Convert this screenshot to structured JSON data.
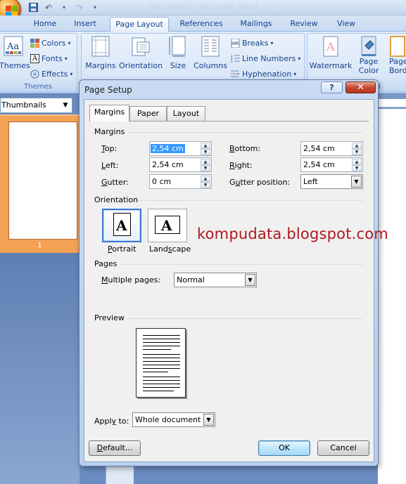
{
  "window": {
    "title_text": "Document1 - Microsoft Word"
  },
  "ribbon": {
    "tabs": [
      "Home",
      "Insert",
      "Page Layout",
      "References",
      "Mailings",
      "Review",
      "View"
    ],
    "active_tab": "Page Layout",
    "themes_group": {
      "themes_label": "Themes",
      "colors_label": "Colors",
      "fonts_label": "Fonts",
      "effects_label": "Effects",
      "group_label": "Themes"
    },
    "page_setup_group": {
      "margins_label": "Margins",
      "orientation_label": "Orientation",
      "size_label": "Size",
      "columns_label": "Columns",
      "breaks_label": "Breaks",
      "line_numbers_label": "Line Numbers",
      "hyphenation_label": "Hyphenation"
    },
    "background_group": {
      "watermark_label": "Watermark",
      "page_color_label_1": "Page",
      "page_color_label_2": "Color",
      "page_borders_label_1": "Page",
      "page_borders_label_2": "Borde",
      "group_label_fragment": "und"
    }
  },
  "thumbnails": {
    "header": "Thumbnails",
    "page_number": "1"
  },
  "dialog": {
    "title": "Page Setup",
    "help_button": "?",
    "close_button": "✕",
    "tabs": [
      "Margins",
      "Paper",
      "Layout"
    ],
    "active_tab": "Margins",
    "margins_section": "Margins",
    "top_label": "Top:",
    "top_value": "2,54 cm",
    "bottom_label": "Bottom:",
    "bottom_value": "2,54 cm",
    "left_label": "Left:",
    "left_value": "2,54 cm",
    "right_label": "Right:",
    "right_value": "2,54 cm",
    "gutter_label": "Gutter:",
    "gutter_value": "0 cm",
    "gutter_position_label": "Gutter position:",
    "gutter_position_value": "Left",
    "orientation_section": "Orientation",
    "portrait_label": "Portrait",
    "landscape_label": "Landscape",
    "orientation_selected": "Portrait",
    "pages_section": "Pages",
    "multiple_pages_label": "Multiple pages:",
    "multiple_pages_value": "Normal",
    "preview_section": "Preview",
    "apply_to_label": "Apply to:",
    "apply_to_value": "Whole document",
    "default_button": "Default...",
    "ok_button": "OK",
    "cancel_button": "Cancel"
  },
  "watermark_text": "kompudata.blogspot.com",
  "colors": {
    "accent": "#3399ff",
    "dialog_frame": "#c8dbf2",
    "watermark": "#b0181e",
    "close_red": "#c7472f"
  }
}
